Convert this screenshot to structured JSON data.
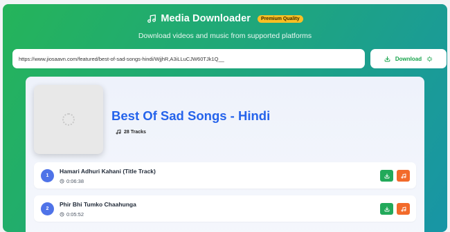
{
  "header": {
    "title": "Media Downloader",
    "badge": "Premium Quality",
    "subtitle": "Download videos and music from supported platforms"
  },
  "search": {
    "value": "https://www.jiosaavn.com/featured/best-of-sad-songs-hindi/WjjhR,A3iLLuCJW60TJk1Q__",
    "button_label": "Download"
  },
  "album": {
    "title": "Best Of Sad Songs - Hindi",
    "track_count": "28 Tracks"
  },
  "tracks": [
    {
      "number": "1",
      "title": "Hamari Adhuri Kahani (Title Track)",
      "duration": "0:06:38"
    },
    {
      "number": "2",
      "title": "Phir Bhi Tumko Chaahunga",
      "duration": "0:05:52"
    }
  ],
  "colors": {
    "accent_blue": "#2563eb",
    "download_green": "#22a95a",
    "audio_orange": "#f26a2a",
    "badge_yellow": "#fbbf24"
  },
  "icons": {
    "title": "music-note-icon",
    "download": "download-icon",
    "sparkle": "sparkle-icon",
    "clock": "clock-icon"
  }
}
